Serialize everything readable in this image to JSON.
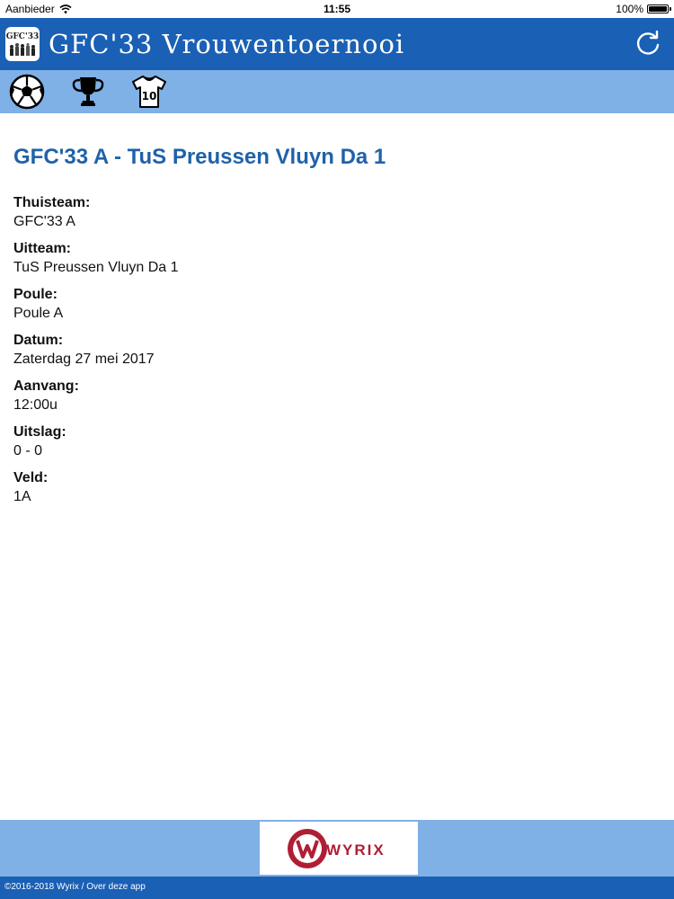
{
  "status_bar": {
    "carrier": "Aanbieder",
    "time": "11:55",
    "battery": "100%"
  },
  "header": {
    "logo_text": "GFC'33",
    "title": "GFC'33 Vrouwentoernooi",
    "refresh_icon": "refresh-icon"
  },
  "toolbar": {
    "icons": [
      "soccer-ball-icon",
      "trophy-icon",
      "jersey-icon"
    ],
    "jersey_number": "10"
  },
  "match": {
    "title": "GFC'33 A - TuS Preussen Vluyn Da 1",
    "fields": [
      {
        "label": "Thuisteam:",
        "value": "GFC'33 A"
      },
      {
        "label": "Uitteam:",
        "value": "TuS Preussen Vluyn Da 1"
      },
      {
        "label": "Poule:",
        "value": "Poule A"
      },
      {
        "label": "Datum:",
        "value": "Zaterdag 27 mei 2017"
      },
      {
        "label": "Aanvang:",
        "value": "12:00u"
      },
      {
        "label": "Uitslag:",
        "value": "0 - 0"
      },
      {
        "label": "Veld:",
        "value": "1A"
      }
    ]
  },
  "footer": {
    "sponsor_name": "WYRIX",
    "copyright": "©2016-2018 Wyrix / Over deze app"
  },
  "colors": {
    "header_bg": "#1a60b5",
    "toolbar_bg": "#7fb0e6",
    "title_blue": "#1f62a8",
    "sponsor_red": "#b01e34"
  }
}
